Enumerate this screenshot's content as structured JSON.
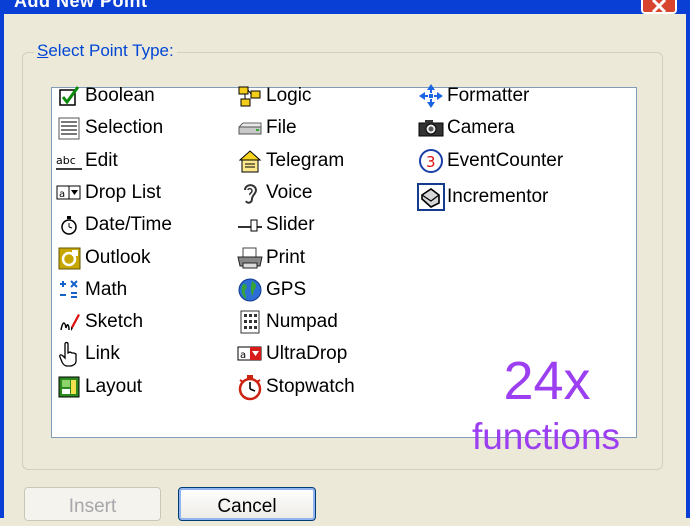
{
  "window": {
    "title": "Add New Point"
  },
  "group": {
    "label_accel": "S",
    "label_rest": "elect Point Type:"
  },
  "point_types": [
    {
      "label": "Boolean",
      "icon": "checkbox-icon"
    },
    {
      "label": "Selection",
      "icon": "list-lines-icon"
    },
    {
      "label": "Edit",
      "icon": "textbox-abc-icon"
    },
    {
      "label": "Drop List",
      "icon": "dropdown-icon"
    },
    {
      "label": "Date/Time",
      "icon": "stopwatch-clock-icon"
    },
    {
      "label": "Outlook",
      "icon": "outlook-icon"
    },
    {
      "label": "Math",
      "icon": "math-operators-icon"
    },
    {
      "label": "Sketch",
      "icon": "sketch-pen-icon"
    },
    {
      "label": "Link",
      "icon": "hand-pointer-icon"
    },
    {
      "label": "Layout",
      "icon": "layout-icon"
    },
    {
      "label": "Logic",
      "icon": "logic-blocks-icon"
    },
    {
      "label": "File",
      "icon": "file-drive-icon"
    },
    {
      "label": "Telegram",
      "icon": "telegram-house-icon"
    },
    {
      "label": "Voice",
      "icon": "ear-icon"
    },
    {
      "label": "Slider",
      "icon": "slider-icon"
    },
    {
      "label": "Print",
      "icon": "printer-icon"
    },
    {
      "label": "GPS",
      "icon": "globe-icon"
    },
    {
      "label": "Numpad",
      "icon": "numpad-icon"
    },
    {
      "label": "UltraDrop",
      "icon": "ultradrop-icon"
    },
    {
      "label": "Stopwatch",
      "icon": "stopwatch-icon"
    },
    {
      "label": "Formatter",
      "icon": "formatter-arrows-icon"
    },
    {
      "label": "Camera",
      "icon": "camera-icon"
    },
    {
      "label": "EventCounter",
      "icon": "counter-3-icon"
    },
    {
      "label": "Incrementor",
      "icon": "incrementor-icon"
    }
  ],
  "promo": {
    "count": "24x",
    "word": "functions"
  },
  "buttons": {
    "insert": "Insert",
    "cancel": "Cancel"
  },
  "colors": {
    "titlebar": "#0a3fd6",
    "dialog": "#ece9d8",
    "accent_purple": "#9b3ff0",
    "legend_blue": "#0046d5"
  }
}
